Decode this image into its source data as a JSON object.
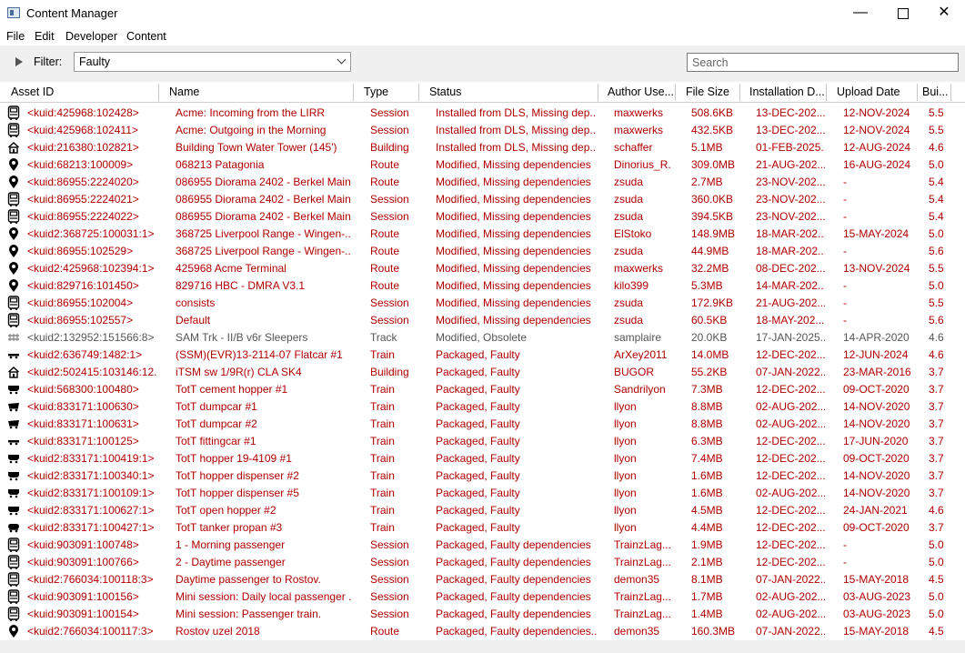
{
  "window": {
    "title": "Content Manager",
    "minimize": "—",
    "close": "✕"
  },
  "menu": [
    "File",
    "Edit",
    "Developer",
    "Content"
  ],
  "filter": {
    "label": "Filter:",
    "value": "Faulty",
    "search_placeholder": "Search"
  },
  "columns": [
    "Asset ID",
    "Name",
    "Type",
    "Status",
    "Author Use...",
    "File Size",
    "Installation D...",
    "Upload Date",
    "Bui..."
  ],
  "colors": {
    "red": "#b00000",
    "gray": "#555555"
  },
  "rows": [
    {
      "icon": "session-icon",
      "color": "red",
      "id": "<kuid:425968:102428>",
      "name": "Acme: Incoming from the LIRR",
      "type": "Session",
      "status": "Installed from DLS, Missing dep...",
      "author": "maxwerks",
      "size": "508.6KB",
      "installed": "13-DEC-202...",
      "uploaded": "12-NOV-2024",
      "build": "5.5"
    },
    {
      "icon": "session-icon",
      "color": "red",
      "id": "<kuid:425968:102411>",
      "name": "Acme: Outgoing in the Morning",
      "type": "Session",
      "status": "Installed from DLS, Missing dep...",
      "author": "maxwerks",
      "size": "432.5KB",
      "installed": "13-DEC-202...",
      "uploaded": "12-NOV-2024",
      "build": "5.5"
    },
    {
      "icon": "building-icon",
      "color": "red",
      "id": "<kuid:216380:102821>",
      "name": "Building Town Water Tower (145')",
      "type": "Building",
      "status": "Installed from DLS, Missing dep...",
      "author": "schaffer",
      "size": "5.1MB",
      "installed": "01-FEB-2025...",
      "uploaded": "12-AUG-2024",
      "build": "4.6"
    },
    {
      "icon": "route-icon",
      "color": "red",
      "id": "<kuid:68213:100009>",
      "name": "068213 Patagonia",
      "type": "Route",
      "status": "Modified, Missing dependencies",
      "author": "Dinorius_R...",
      "size": "309.0MB",
      "installed": "21-AUG-202...",
      "uploaded": "16-AUG-2024",
      "build": "5.0"
    },
    {
      "icon": "route-icon",
      "color": "red",
      "id": "<kuid:86955:2224020>",
      "name": "086955 Diorama 2402 - Berkel Main",
      "type": "Route",
      "status": "Modified, Missing dependencies",
      "author": "zsuda",
      "size": "2.7MB",
      "installed": "23-NOV-202...",
      "uploaded": "-",
      "build": "5.4"
    },
    {
      "icon": "session-icon",
      "color": "red",
      "id": "<kuid:86955:2224021>",
      "name": "086955 Diorama 2402 - Berkel Main...",
      "type": "Session",
      "status": "Modified, Missing dependencies",
      "author": "zsuda",
      "size": "360.0KB",
      "installed": "23-NOV-202...",
      "uploaded": "-",
      "build": "5.4"
    },
    {
      "icon": "session-icon",
      "color": "red",
      "id": "<kuid:86955:2224022>",
      "name": "086955 Diorama 2402 - Berkel Main...",
      "type": "Session",
      "status": "Modified, Missing dependencies",
      "author": "zsuda",
      "size": "394.5KB",
      "installed": "23-NOV-202...",
      "uploaded": "-",
      "build": "5.4"
    },
    {
      "icon": "route-icon",
      "color": "red",
      "id": "<kuid2:368725:100031:1>",
      "name": "368725 Liverpool Range - Wingen-...",
      "type": "Route",
      "status": "Modified, Missing dependencies",
      "author": "ElStoko",
      "size": "148.9MB",
      "installed": "18-MAR-202...",
      "uploaded": "15-MAY-2024",
      "build": "5.0"
    },
    {
      "icon": "route-icon",
      "color": "red",
      "id": "<kuid:86955:102529>",
      "name": "368725 Liverpool Range - Wingen-...",
      "type": "Route",
      "status": "Modified, Missing dependencies",
      "author": "zsuda",
      "size": "44.9MB",
      "installed": "18-MAR-202...",
      "uploaded": "-",
      "build": "5.6"
    },
    {
      "icon": "route-icon",
      "color": "red",
      "id": "<kuid2:425968:102394:1>",
      "name": "425968 Acme Terminal",
      "type": "Route",
      "status": "Modified, Missing dependencies",
      "author": "maxwerks",
      "size": "32.2MB",
      "installed": "08-DEC-202...",
      "uploaded": "13-NOV-2024",
      "build": "5.5"
    },
    {
      "icon": "route-icon",
      "color": "red",
      "id": "<kuid:829716:101450>",
      "name": "829716 HBC - DMRA V3.1",
      "type": "Route",
      "status": "Modified, Missing dependencies",
      "author": "kilo399",
      "size": "5.3MB",
      "installed": "14-MAR-202...",
      "uploaded": "-",
      "build": "5.0"
    },
    {
      "icon": "session-icon",
      "color": "red",
      "id": "<kuid:86955:102004>",
      "name": "consists",
      "type": "Session",
      "status": "Modified, Missing dependencies",
      "author": "zsuda",
      "size": "172.9KB",
      "installed": "21-AUG-202...",
      "uploaded": "-",
      "build": "5.5"
    },
    {
      "icon": "session-icon",
      "color": "red",
      "id": "<kuid:86955:102557>",
      "name": "Default",
      "type": "Session",
      "status": "Modified, Missing dependencies",
      "author": "zsuda",
      "size": "60.5KB",
      "installed": "18-MAY-202...",
      "uploaded": "-",
      "build": "5.6"
    },
    {
      "icon": "track-icon",
      "color": "gray",
      "id": "<kuid2:132952:151566:8>",
      "name": "SAM Trk - II/B v6r Sleepers",
      "type": "Track",
      "status": "Modified, Obsolete",
      "author": "samplaire",
      "size": "20.0KB",
      "installed": "17-JAN-2025...",
      "uploaded": "14-APR-2020",
      "build": "4.6"
    },
    {
      "icon": "flatcar-icon",
      "color": "red",
      "id": "<kuid2:636749:1482:1>",
      "name": "(SSM)(EVR)13-2114-07 Flatcar #1",
      "type": "Train",
      "status": "Packaged, Faulty",
      "author": "ArXey2011",
      "size": "14.0MB",
      "installed": "12-DEC-202...",
      "uploaded": "12-JUN-2024",
      "build": "4.6"
    },
    {
      "icon": "building-icon",
      "color": "red",
      "id": "<kuid2:502415:103146:12...",
      "name": "iTSM sw 1/9R(r) CLA SK4",
      "type": "Building",
      "status": "Packaged, Faulty",
      "author": "BUGOR",
      "size": "55.2KB",
      "installed": "07-JAN-2022...",
      "uploaded": "23-MAR-2016",
      "build": "3.7"
    },
    {
      "icon": "hopper-icon",
      "color": "red",
      "id": "<kuid:568300:100480>",
      "name": "TotT cement hopper #1",
      "type": "Train",
      "status": "Packaged, Faulty",
      "author": "Sandrilyon",
      "size": "7.3MB",
      "installed": "12-DEC-202...",
      "uploaded": "09-OCT-2020",
      "build": "3.7"
    },
    {
      "icon": "dumpcar-icon",
      "color": "red",
      "id": "<kuid:833171:100630>",
      "name": "TotT dumpcar #1",
      "type": "Train",
      "status": "Packaged, Faulty",
      "author": "llyon",
      "size": "8.8MB",
      "installed": "02-AUG-202...",
      "uploaded": "14-NOV-2020",
      "build": "3.7"
    },
    {
      "icon": "dumpcar-icon",
      "color": "red",
      "id": "<kuid:833171:100631>",
      "name": "TotT dumpcar #2",
      "type": "Train",
      "status": "Packaged, Faulty",
      "author": "llyon",
      "size": "8.8MB",
      "installed": "02-AUG-202...",
      "uploaded": "14-NOV-2020",
      "build": "3.7"
    },
    {
      "icon": "flatcar-icon",
      "color": "red",
      "id": "<kuid:833171:100125>",
      "name": "TotT fittingcar #1",
      "type": "Train",
      "status": "Packaged, Faulty",
      "author": "llyon",
      "size": "6.3MB",
      "installed": "12-DEC-202...",
      "uploaded": "17-JUN-2020",
      "build": "3.7"
    },
    {
      "icon": "hopper-icon",
      "color": "red",
      "id": "<kuid2:833171:100419:1>",
      "name": "TotT hopper 19-4109 #1",
      "type": "Train",
      "status": "Packaged, Faulty",
      "author": "llyon",
      "size": "7.4MB",
      "installed": "12-DEC-202...",
      "uploaded": "09-OCT-2020",
      "build": "3.7"
    },
    {
      "icon": "hopper-icon",
      "color": "red",
      "id": "<kuid2:833171:100340:1>",
      "name": "TotT hopper dispenser #2",
      "type": "Train",
      "status": "Packaged, Faulty",
      "author": "llyon",
      "size": "1.6MB",
      "installed": "12-DEC-202...",
      "uploaded": "14-NOV-2020",
      "build": "3.7"
    },
    {
      "icon": "hopper-icon",
      "color": "red",
      "id": "<kuid2:833171:100109:1>",
      "name": "TotT hopper dispenser #5",
      "type": "Train",
      "status": "Packaged, Faulty",
      "author": "llyon",
      "size": "1.6MB",
      "installed": "02-AUG-202...",
      "uploaded": "14-NOV-2020",
      "build": "3.7"
    },
    {
      "icon": "hopper-icon",
      "color": "red",
      "id": "<kuid2:833171:100627:1>",
      "name": "TotT open hopper #2",
      "type": "Train",
      "status": "Packaged, Faulty",
      "author": "llyon",
      "size": "4.5MB",
      "installed": "12-DEC-202...",
      "uploaded": "24-JAN-2021",
      "build": "4.6"
    },
    {
      "icon": "tanker-icon",
      "color": "red",
      "id": "<kuid2:833171:100427:1>",
      "name": "TotT tanker propan #3",
      "type": "Train",
      "status": "Packaged, Faulty",
      "author": "llyon",
      "size": "4.4MB",
      "installed": "12-DEC-202...",
      "uploaded": "09-OCT-2020",
      "build": "3.7"
    },
    {
      "icon": "session-icon",
      "color": "red",
      "id": "<kuid:903091:100748>",
      "name": "1 - Morning passenger",
      "type": "Session",
      "status": "Packaged, Faulty dependencies",
      "author": "TrainzLag...",
      "size": "1.9MB",
      "installed": "12-DEC-202...",
      "uploaded": "-",
      "build": "5.0"
    },
    {
      "icon": "session-icon",
      "color": "red",
      "id": "<kuid:903091:100766>",
      "name": "2 - Daytime passenger",
      "type": "Session",
      "status": "Packaged, Faulty dependencies",
      "author": "TrainzLag...",
      "size": "2.1MB",
      "installed": "12-DEC-202...",
      "uploaded": "-",
      "build": "5.0"
    },
    {
      "icon": "session-icon",
      "color": "red",
      "id": "<kuid2:766034:100118:3>",
      "name": "Daytime passenger to Rostov.",
      "type": "Session",
      "status": "Packaged, Faulty dependencies",
      "author": "demon35",
      "size": "8.1MB",
      "installed": "07-JAN-2022...",
      "uploaded": "15-MAY-2018",
      "build": "4.5"
    },
    {
      "icon": "session-icon",
      "color": "red",
      "id": "<kuid:903091:100156>",
      "name": "Mini session: Daily local passenger ...",
      "type": "Session",
      "status": "Packaged, Faulty dependencies",
      "author": "TrainzLag...",
      "size": "1.7MB",
      "installed": "02-AUG-202...",
      "uploaded": "03-AUG-2023",
      "build": "5.0"
    },
    {
      "icon": "session-icon",
      "color": "red",
      "id": "<kuid:903091:100154>",
      "name": "Mini session: Passenger train.",
      "type": "Session",
      "status": "Packaged, Faulty dependencies",
      "author": "TrainzLag...",
      "size": "1.4MB",
      "installed": "02-AUG-202...",
      "uploaded": "03-AUG-2023",
      "build": "5.0"
    },
    {
      "icon": "route-icon",
      "color": "red",
      "id": "<kuid2:766034:100117:3>",
      "name": "Rostov uzel 2018",
      "type": "Route",
      "status": "Packaged, Faulty dependencies...",
      "author": "demon35",
      "size": "160.3MB",
      "installed": "07-JAN-2022...",
      "uploaded": "15-MAY-2018",
      "build": "4.5"
    }
  ]
}
